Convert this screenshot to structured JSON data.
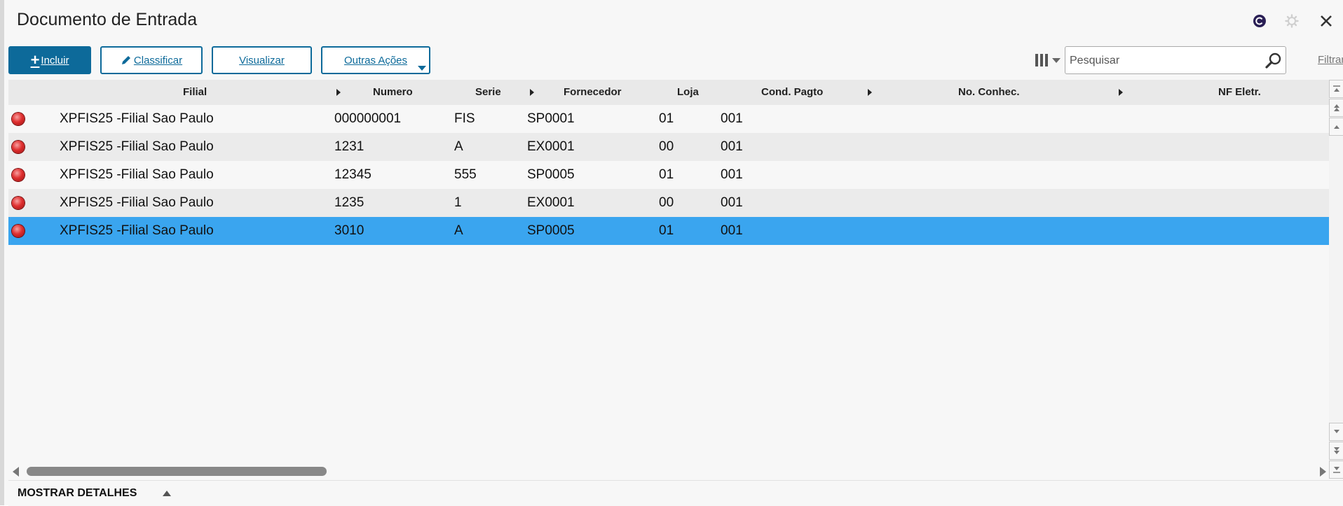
{
  "window": {
    "title": "Documento de Entrada"
  },
  "toolbar": {
    "incluir_label": "Incluir",
    "classificar_label": "Classificar",
    "visualizar_label": "Visualizar",
    "outras_acoes_label": "Outras Ações",
    "search_placeholder": "Pesquisar",
    "filtrar_label": "Filtrar"
  },
  "table": {
    "columns": [
      {
        "label": "Filial",
        "sortable": false
      },
      {
        "label": "Numero",
        "sortable": true
      },
      {
        "label": "Serie",
        "sortable": false
      },
      {
        "label": "Fornecedor",
        "sortable": true
      },
      {
        "label": "Loja",
        "sortable": false
      },
      {
        "label": "Cond. Pagto",
        "sortable": false
      },
      {
        "label": "No. Conhec.",
        "sortable": true
      },
      {
        "label": "NF Eletr.",
        "sortable": true
      }
    ],
    "rows": [
      {
        "status": "red",
        "filial": "XPFIS25 -Filial Sao Paulo",
        "numero": "000000001",
        "serie": "FIS",
        "fornecedor": "SP0001",
        "loja": "01",
        "cond_pagto": "001"
      },
      {
        "status": "red",
        "filial": "XPFIS25 -Filial Sao Paulo",
        "numero": "1231",
        "serie": "A",
        "fornecedor": "EX0001",
        "loja": "00",
        "cond_pagto": "001"
      },
      {
        "status": "red",
        "filial": "XPFIS25 -Filial Sao Paulo",
        "numero": "12345",
        "serie": "555",
        "fornecedor": "SP0005",
        "loja": "01",
        "cond_pagto": "001"
      },
      {
        "status": "red",
        "filial": "XPFIS25 -Filial Sao Paulo",
        "numero": "1235",
        "serie": "1",
        "fornecedor": "EX0001",
        "loja": "00",
        "cond_pagto": "001"
      },
      {
        "status": "red",
        "filial": "XPFIS25 -Filial Sao Paulo",
        "numero": "3010",
        "serie": "A",
        "fornecedor": "SP0005",
        "loja": "01",
        "cond_pagto": "001",
        "selected": true
      }
    ]
  },
  "footer": {
    "details_label": "MOSTRAR DETALHES"
  },
  "colors": {
    "primary": "#0d6a9a",
    "selected_row": "#3aa5ef",
    "alt_row": "#ebebeb",
    "status_red": "#e03030"
  },
  "icons": {
    "status": "red-circle-icon",
    "search": "magnifier-icon",
    "columns": "column-picker-icon",
    "close": "close-icon",
    "settings": "gear-icon"
  }
}
